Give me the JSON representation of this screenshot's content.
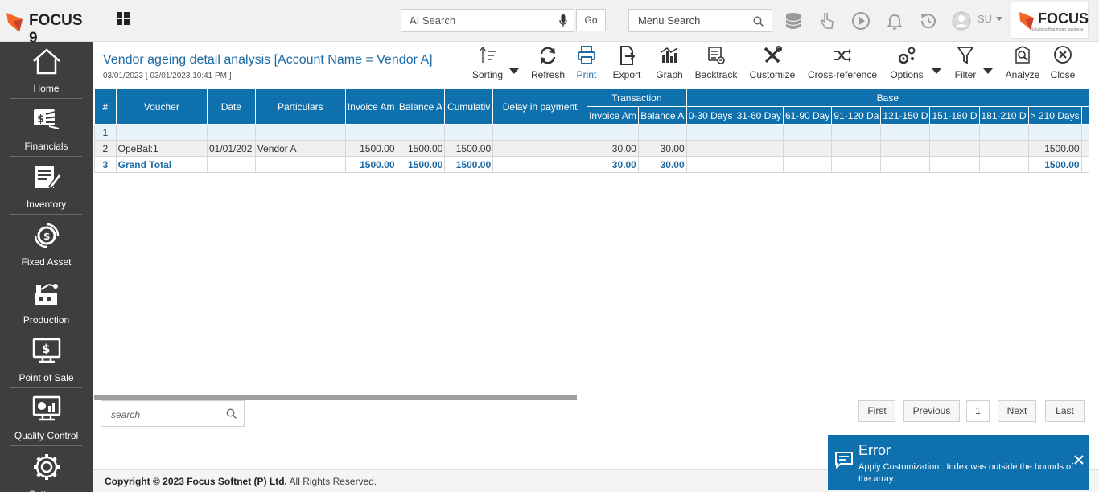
{
  "topbar": {
    "logo_text": "FOCUS 9",
    "ai_search_placeholder": "AI Search",
    "go_label": "Go",
    "menu_search_placeholder": "Menu Search",
    "user_initials": "SU",
    "brand_text": "FOCUS",
    "brand_tagline": "Solutions that mean business",
    "icons": [
      "database-icon",
      "pointer-hand-icon",
      "play-icon",
      "bell-icon",
      "history-icon",
      "user-avatar-icon"
    ]
  },
  "sidebar": {
    "items": [
      {
        "label": "Home",
        "icon": "home-icon"
      },
      {
        "label": "Financials",
        "icon": "financials-icon"
      },
      {
        "label": "Inventory",
        "icon": "inventory-icon"
      },
      {
        "label": "Fixed Asset",
        "icon": "fixed-asset-icon"
      },
      {
        "label": "Production",
        "icon": "production-icon"
      },
      {
        "label": "Point of Sale",
        "icon": "point-of-sale-icon"
      },
      {
        "label": "Quality Control",
        "icon": "quality-control-icon"
      },
      {
        "label": "Settings",
        "icon": "gear-icon"
      }
    ]
  },
  "report": {
    "title": "Vendor ageing detail analysis [Account Name = Vendor A]",
    "subtitle": "03/01/2023 [ 03/01/2023 10:41 PM ]"
  },
  "toolbar": {
    "sorting": "Sorting",
    "refresh": "Refresh",
    "print": "Print",
    "export": "Export",
    "graph": "Graph",
    "backtrack": "Backtrack",
    "customize": "Customize",
    "cross_reference": "Cross-reference",
    "options": "Options",
    "filter": "Filter",
    "analyze": "Analyze",
    "close": "Close"
  },
  "table": {
    "headers": {
      "num": "#",
      "voucher": "Voucher",
      "date": "Date",
      "particulars": "Particulars",
      "invoice_amount": "Invoice Am",
      "balance_amount": "Balance A",
      "cumulative": "Cumulativ",
      "delay": "Delay in payment",
      "transaction_group": "Transaction",
      "base_group": "Base",
      "txn_invoice": "Invoice Am",
      "txn_balance": "Balance A",
      "b_0_30": "0-30 Days",
      "b_31_60": "31-60 Day",
      "b_61_90": "61-90 Day",
      "b_91_120": "91-120 Da",
      "b_121_150": "121-150 D",
      "b_151_180": "151-180 D",
      "b_181_210": "181-210 D",
      "b_210_plus": "> 210 Days"
    },
    "rows": [
      {
        "num": "1",
        "voucher": "",
        "date": "",
        "particulars": "",
        "invoice": "",
        "balance": "",
        "cumulative": "",
        "delay": "",
        "txn_invoice": "",
        "txn_balance": "",
        "over210": ""
      },
      {
        "num": "2",
        "voucher": "OpeBal:1",
        "date": "01/01/202",
        "particulars": "Vendor A",
        "invoice": "1500.00",
        "balance": "1500.00",
        "cumulative": "1500.00",
        "delay": "",
        "txn_invoice": "30.00",
        "txn_balance": "30.00",
        "over210": "1500.00"
      },
      {
        "num": "3",
        "voucher": "Grand Total",
        "date": "",
        "particulars": "",
        "invoice": "1500.00",
        "balance": "1500.00",
        "cumulative": "1500.00",
        "delay": "",
        "txn_invoice": "30.00",
        "txn_balance": "30.00",
        "over210": "1500.00"
      }
    ]
  },
  "search": {
    "placeholder": "search"
  },
  "pager": {
    "first": "First",
    "previous": "Previous",
    "page": "1",
    "next": "Next",
    "last": "Last"
  },
  "footer": {
    "copyright": "Copyright © 2023",
    "company": "Focus Softnet (P) Ltd.",
    "rights": "All Rights Reserved."
  },
  "toast": {
    "title": "Error",
    "message": "Apply Customization : Index was outside the bounds of the array."
  },
  "colors": {
    "primary_blue": "#0e70ad",
    "title_blue": "#1d6aa5",
    "sidebar_bg": "#3e3e3e",
    "logo_orange": "#f26522"
  }
}
